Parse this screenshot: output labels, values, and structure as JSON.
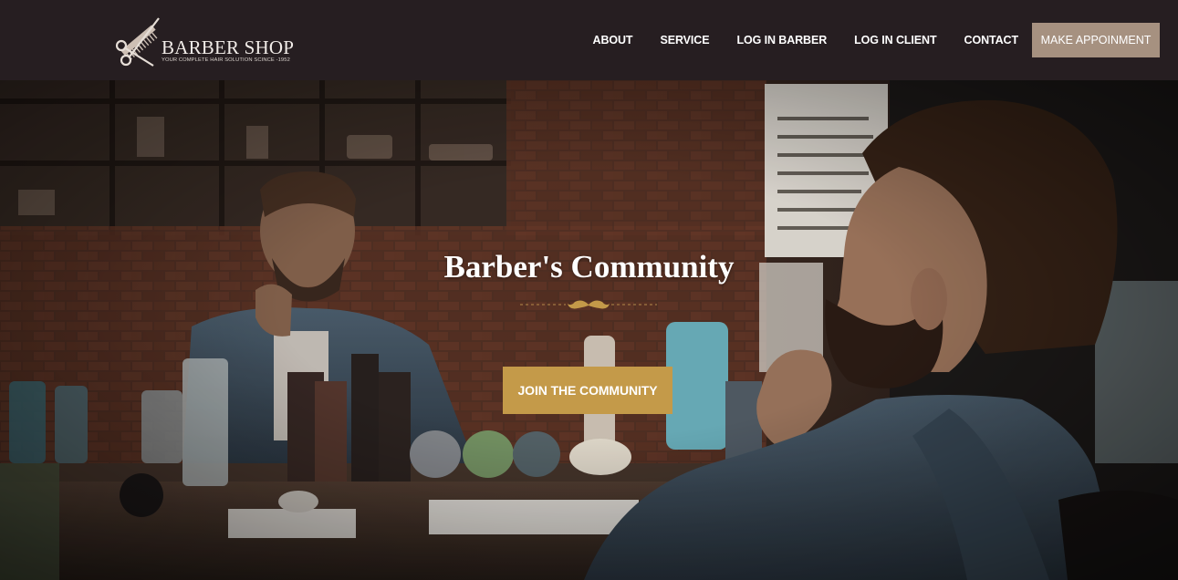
{
  "brand": {
    "name": "BARBER SHOP",
    "tagline": "YOUR COMPLETE HAIR SOLUTION SCINCE -1952",
    "logo_icon": "scissors-comb-icon"
  },
  "nav": {
    "items": [
      {
        "label": "ABOUT"
      },
      {
        "label": "SERVICE"
      },
      {
        "label": "LOG IN BARBER"
      },
      {
        "label": "LOG IN CLIENT"
      },
      {
        "label": "CONTACT"
      }
    ],
    "cta_label": "MAKE APPOINMENT"
  },
  "hero": {
    "title": "Barber's Community",
    "divider_icon": "mustache-icon",
    "button_label": "JOIN THE COMMUNITY"
  },
  "colors": {
    "header_bg": "#261e21",
    "cta_bg": "#a69180",
    "accent_gold": "#c49a49",
    "text_light": "#ffffff"
  }
}
